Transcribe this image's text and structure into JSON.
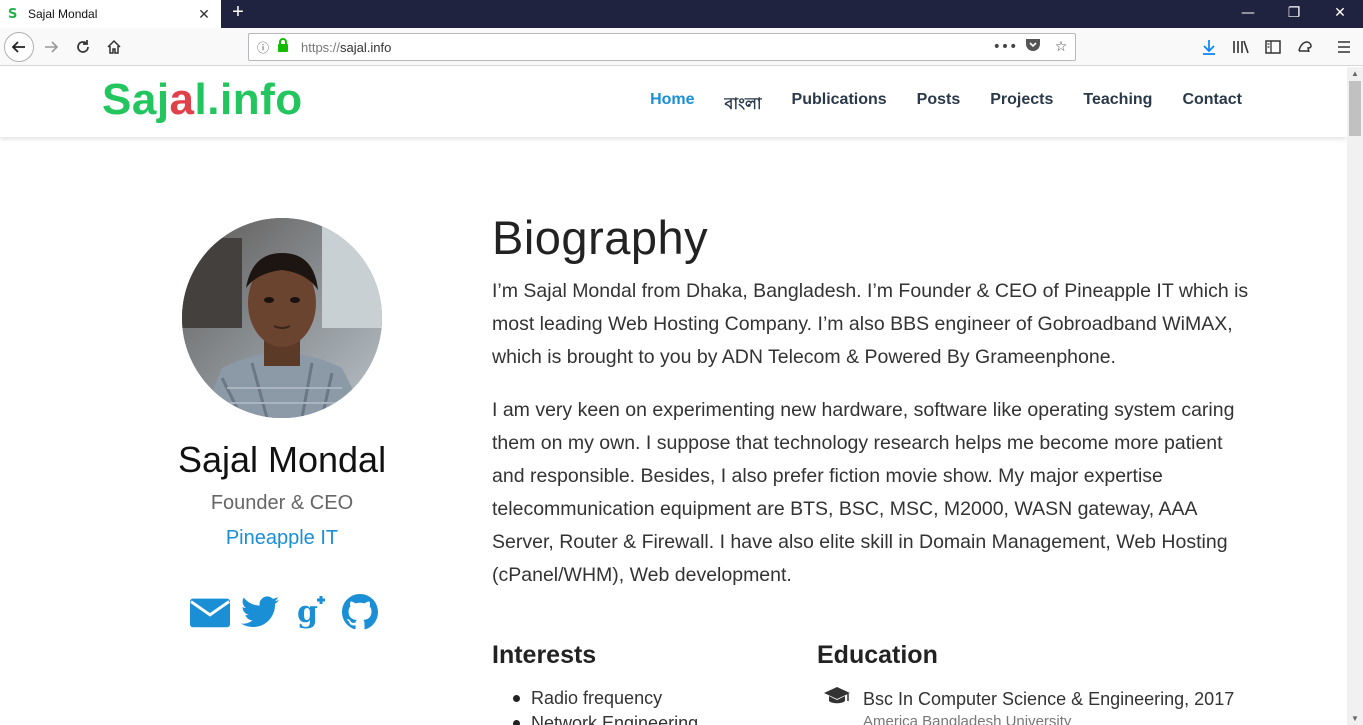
{
  "browser": {
    "tab_title": "Sajal Mondal",
    "tab_favicon": "S",
    "url_protocol": "https://",
    "url_host": "sajal.info"
  },
  "site": {
    "logo_main": "Saj",
    "logo_accent": "a",
    "logo_rest": "l.info",
    "nav": [
      "Home",
      "বাংলা",
      "Publications",
      "Posts",
      "Projects",
      "Teaching",
      "Contact"
    ],
    "active_nav": "Home"
  },
  "profile": {
    "name": "Sajal Mondal",
    "role": "Founder & CEO",
    "organization": "Pineapple IT",
    "socials": [
      "envelope-icon",
      "twitter-icon",
      "google-plus-icon",
      "github-icon"
    ]
  },
  "biography": {
    "title": "Biography",
    "paragraphs": [
      "I’m Sajal Mondal from Dhaka, Bangladesh. I’m Founder & CEO of Pineapple IT which is most leading Web Hosting Company. I’m also BBS engineer of Gobroadband WiMAX, which is brought to you by ADN Telecom & Powered By Grameenphone.",
      "I am very keen on experimenting new hardware, software like operating system caring them on my own. I suppose that technology research helps me become more patient and responsible. Besides, I also prefer fiction movie show. My major expertise telecommunication equipment are BTS, BSC, MSC, M2000, WASN gateway, AAA Server, Router & Firewall. I have also elite skill in Domain Management, Web Hosting (cPanel/WHM), Web development."
    ]
  },
  "interests": {
    "title": "Interests",
    "items": [
      "Radio frequency",
      "Network Engineering"
    ]
  },
  "education": {
    "title": "Education",
    "items": [
      {
        "degree": "Bsc In Computer Science & Engineering, 2017",
        "school": "America Bangladesh University"
      }
    ]
  },
  "colors": {
    "brand_green": "#22c55e",
    "logo_accent": "#e0404a",
    "link_blue": "#1a8fd6",
    "tabbar": "#202340"
  }
}
